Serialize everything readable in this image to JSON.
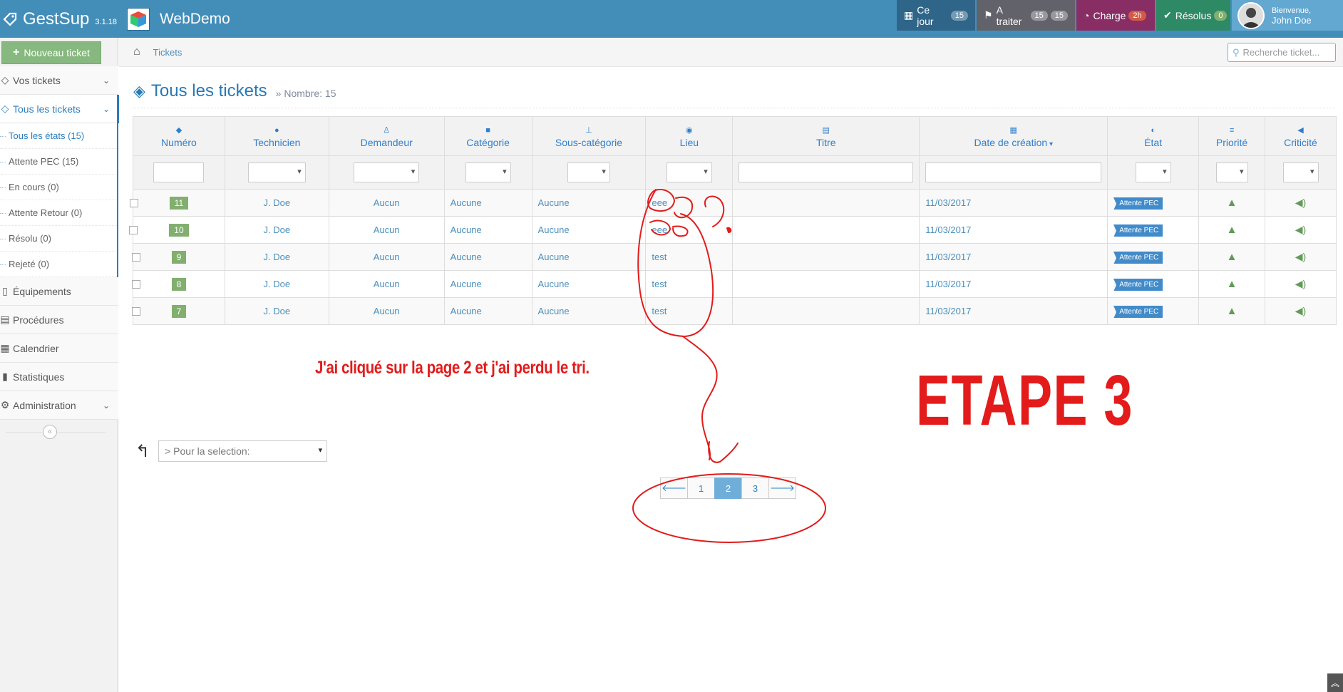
{
  "brand": {
    "name": "GestSup",
    "version": "3.1.18",
    "company": "WebDemo"
  },
  "topnav": {
    "today": {
      "label": "Ce jour",
      "count": "15"
    },
    "todo": {
      "label": "A traiter",
      "count1": "15",
      "count2": "15"
    },
    "charge": {
      "label": "Charge",
      "count": "2h"
    },
    "resolved": {
      "label": "Résolus",
      "count": "0"
    },
    "user": {
      "greeting": "Bienvenue,",
      "name": "John Doe"
    }
  },
  "sidebar": {
    "new_ticket": "Nouveau ticket",
    "items": [
      {
        "label": "Vos tickets"
      },
      {
        "label": "Tous les tickets"
      },
      {
        "label": "Équipements"
      },
      {
        "label": "Procédures"
      },
      {
        "label": "Calendrier"
      },
      {
        "label": "Statistiques"
      },
      {
        "label": "Administration"
      }
    ],
    "sub_items": [
      {
        "label": "Tous les états (15)"
      },
      {
        "label": "Attente PEC (15)"
      },
      {
        "label": "En cours (0)"
      },
      {
        "label": "Attente Retour (0)"
      },
      {
        "label": "Résolu (0)"
      },
      {
        "label": "Rejeté (0)"
      }
    ]
  },
  "breadcrumb": {
    "current": "Tickets"
  },
  "search": {
    "placeholder": "Recherche ticket..."
  },
  "page": {
    "title": "Tous les tickets",
    "count_label": "Nombre: 15"
  },
  "table": {
    "columns": [
      "Numéro",
      "Technicien",
      "Demandeur",
      "Catégorie",
      "Sous-catégorie",
      "Lieu",
      "Titre",
      "Date de création",
      "État",
      "Priorité",
      "Criticité"
    ],
    "rows": [
      {
        "num": "11",
        "tech": "J. Doe",
        "req": "Aucun",
        "cat": "Aucune",
        "subcat": "Aucune",
        "lieu": "eee",
        "titre": "",
        "date": "11/03/2017",
        "state": "Attente PEC"
      },
      {
        "num": "10",
        "tech": "J. Doe",
        "req": "Aucun",
        "cat": "Aucune",
        "subcat": "Aucune",
        "lieu": "eee",
        "titre": "",
        "date": "11/03/2017",
        "state": "Attente PEC"
      },
      {
        "num": "9",
        "tech": "J. Doe",
        "req": "Aucun",
        "cat": "Aucune",
        "subcat": "Aucune",
        "lieu": "test",
        "titre": "",
        "date": "11/03/2017",
        "state": "Attente PEC"
      },
      {
        "num": "8",
        "tech": "J. Doe",
        "req": "Aucun",
        "cat": "Aucune",
        "subcat": "Aucune",
        "lieu": "test",
        "titre": "",
        "date": "11/03/2017",
        "state": "Attente PEC"
      },
      {
        "num": "7",
        "tech": "J. Doe",
        "req": "Aucun",
        "cat": "Aucune",
        "subcat": "Aucune",
        "lieu": "test",
        "titre": "",
        "date": "11/03/2017",
        "state": "Attente PEC"
      }
    ]
  },
  "bulk": {
    "placeholder": "> Pour la selection:"
  },
  "pagination": {
    "pages": [
      "1",
      "2",
      "3"
    ],
    "current": "2"
  },
  "annotations": {
    "note": "J'ai cliqué sur la page 2 et j'ai perdu le tri.",
    "step": "ETAPE 3"
  },
  "colors": {
    "navbar": "#438eb9",
    "accent": "#2679b5",
    "annotation": "#e31b1b",
    "success": "#82af6f"
  }
}
